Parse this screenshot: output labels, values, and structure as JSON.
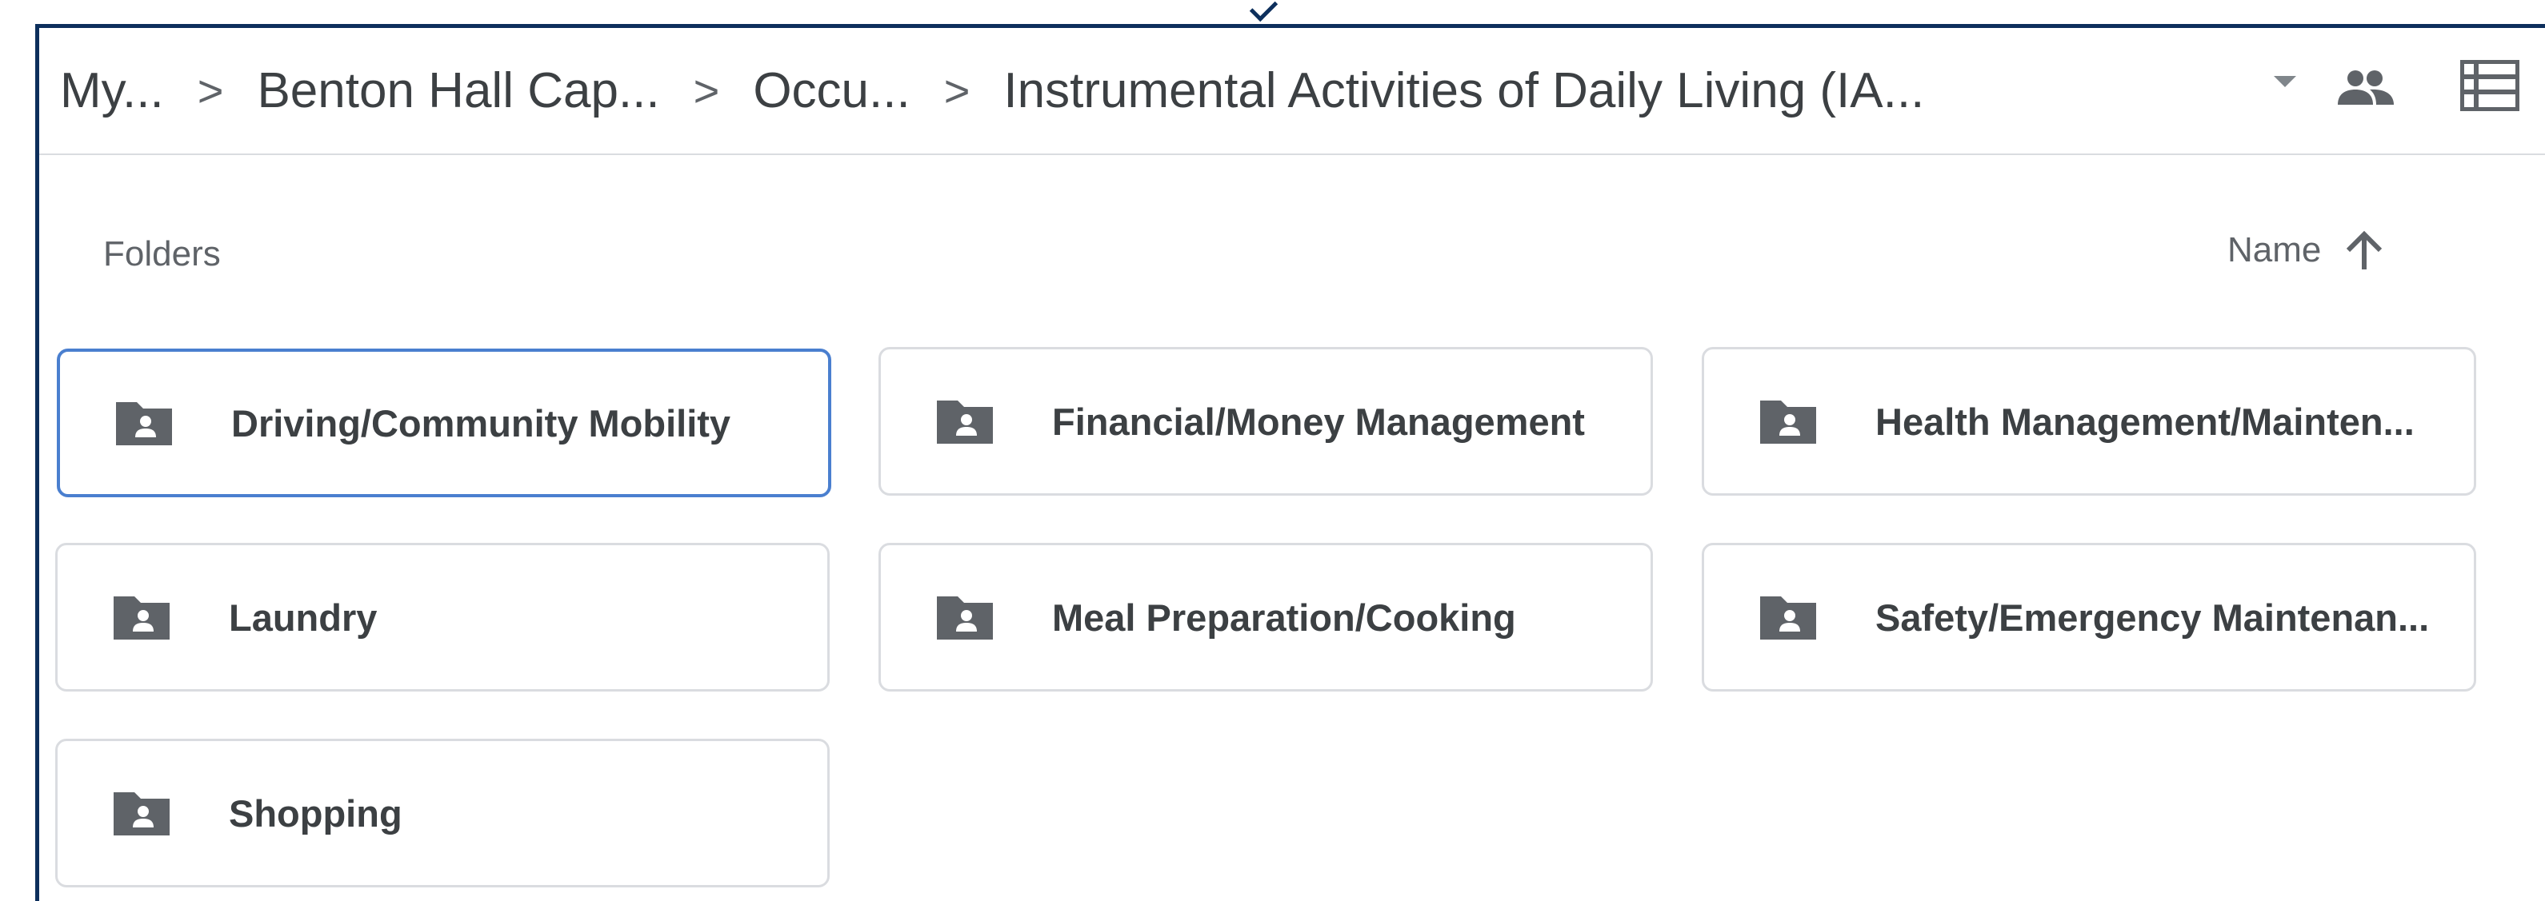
{
  "breadcrumb": {
    "items": [
      {
        "label": "My..."
      },
      {
        "label": "Benton Hall Cap..."
      },
      {
        "label": "Occu..."
      },
      {
        "label": "Instrumental Activities of Daily Living (IA..."
      }
    ],
    "separator": ">"
  },
  "toolbar": {
    "dropdown_icon": "caret-down-icon",
    "shared_icon": "people-icon",
    "view_icon": "list-view-icon"
  },
  "section": {
    "title": "Folders"
  },
  "sort": {
    "label": "Name",
    "direction_icon": "arrow-up-icon"
  },
  "folders": [
    {
      "name": "Driving/Community Mobility",
      "selected": true,
      "icon": "shared-folder-icon"
    },
    {
      "name": "Financial/Money Management",
      "selected": false,
      "icon": "shared-folder-icon"
    },
    {
      "name": "Health Management/Mainten...",
      "selected": false,
      "icon": "shared-folder-icon"
    },
    {
      "name": "Laundry",
      "selected": false,
      "icon": "shared-folder-icon"
    },
    {
      "name": "Meal Preparation/Cooking",
      "selected": false,
      "icon": "shared-folder-icon"
    },
    {
      "name": "Safety/Emergency Maintenan...",
      "selected": false,
      "icon": "shared-folder-icon"
    },
    {
      "name": "Shopping",
      "selected": false,
      "icon": "shared-folder-icon"
    }
  ],
  "colors": {
    "frame": "#0d2f5c",
    "selected_border": "#4a7fcf",
    "card_border": "#dadce0",
    "icon_fill": "#5f6368",
    "text_primary": "#3c4043",
    "text_secondary": "#5f6368"
  }
}
